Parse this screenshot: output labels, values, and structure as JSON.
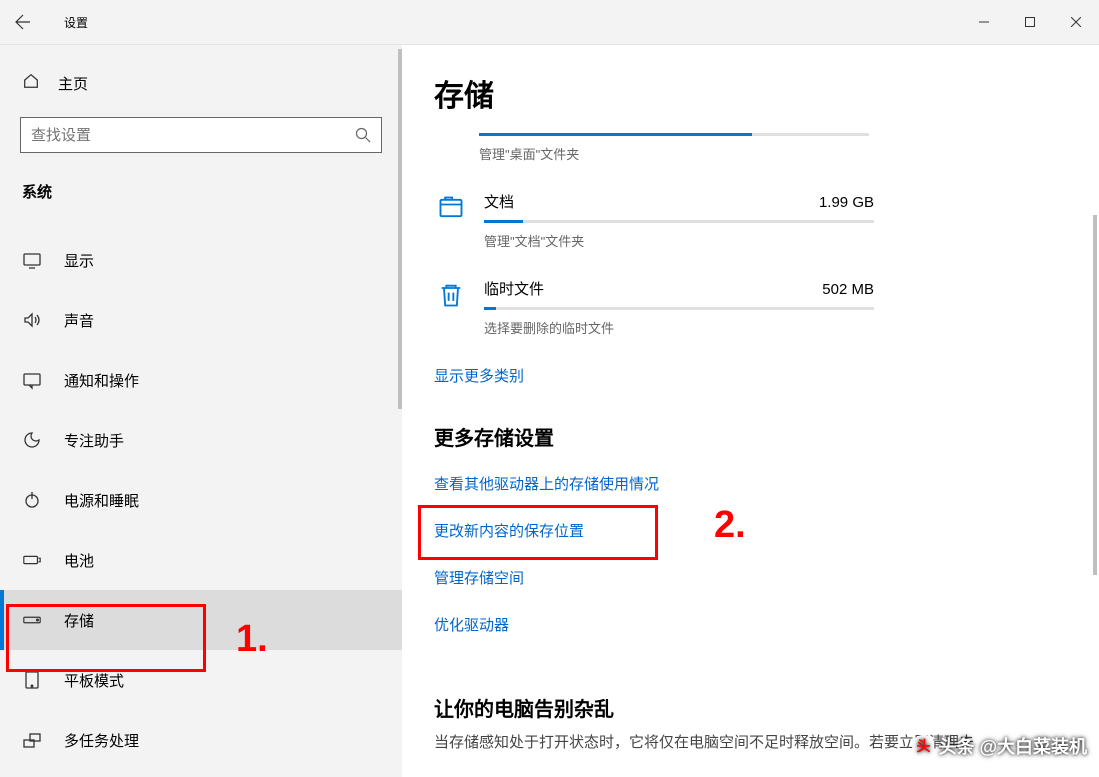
{
  "titlebar": {
    "title": "设置"
  },
  "sidebar": {
    "home": "主页",
    "search_placeholder": "查找设置",
    "group": "系统",
    "items": [
      {
        "icon": "display",
        "label": "显示"
      },
      {
        "icon": "sound",
        "label": "声音"
      },
      {
        "icon": "notify",
        "label": "通知和操作"
      },
      {
        "icon": "focus",
        "label": "专注助手"
      },
      {
        "icon": "power",
        "label": "电源和睡眠"
      },
      {
        "icon": "battery",
        "label": "电池"
      },
      {
        "icon": "storage",
        "label": "存储",
        "selected": true
      },
      {
        "icon": "tablet",
        "label": "平板模式"
      },
      {
        "icon": "multitask",
        "label": "多任务处理"
      }
    ]
  },
  "content": {
    "page_title": "存储",
    "storage": [
      {
        "name": "",
        "size": "",
        "bar_pct": 70,
        "desc": "管理\"桌面\"文件夹",
        "icon": "none",
        "first": true
      },
      {
        "name": "文档",
        "size": "1.99 GB",
        "bar_pct": 10,
        "desc": "管理\"文档\"文件夹",
        "icon": "documents"
      },
      {
        "name": "临时文件",
        "size": "502 MB",
        "bar_pct": 3,
        "desc": "选择要删除的临时文件",
        "icon": "trash"
      }
    ],
    "show_more": "显示更多类别",
    "more_heading": "更多存储设置",
    "more_links": [
      "查看其他驱动器上的存储使用情况",
      "更改新内容的保存位置",
      "管理存储空间",
      "优化驱动器"
    ],
    "declutter_heading": "让你的电脑告别杂乱",
    "declutter_desc": "当存储感知处于打开状态时，它将仅在电脑空间不足时释放空间。若要立即清理未"
  },
  "annotations": {
    "label1": "1.",
    "label2": "2."
  },
  "watermark": "头条 @大白菜装机"
}
